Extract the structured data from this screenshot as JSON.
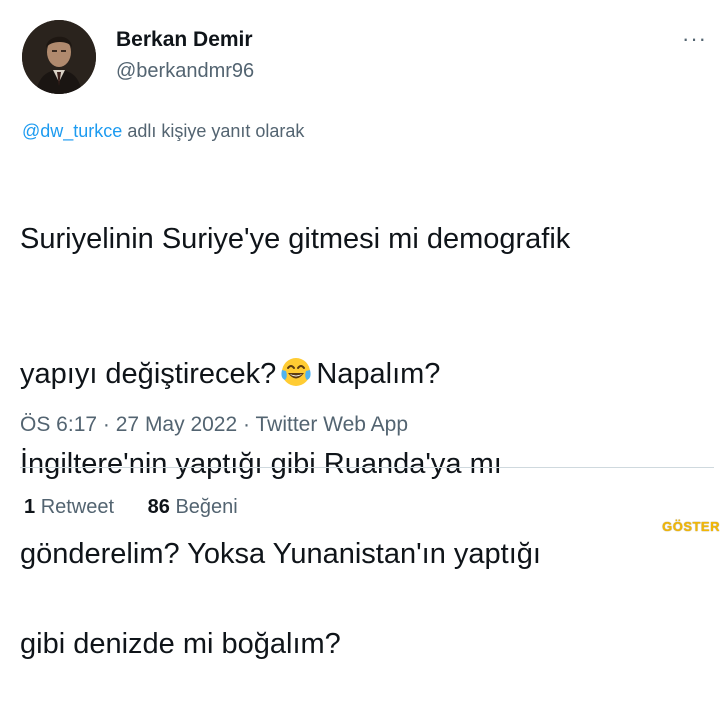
{
  "author": {
    "display_name": "Berkan Demir",
    "handle": "@berkandmr96",
    "avatar_icon": "profile-photo"
  },
  "more_label": "···",
  "reply": {
    "mention": "@dw_turkce",
    "suffix": "adlı kişiye yanıt olarak"
  },
  "tweet": {
    "line1": "Suriyelinin Suriye'ye gitmesi mi demografik",
    "line2_before_emoji": "yapıyı değiştirecek?",
    "emoji_icon": "face-with-tears-of-joy",
    "line2_after_emoji": "Napalım?",
    "line3": "İngiltere'nin yaptığı gibi Ruanda'ya mı",
    "line4": "gönderelim? Yoksa Yunanistan'ın yaptığı",
    "line5": "gibi denizde mi boğalım?"
  },
  "meta": {
    "time": "ÖS 6:17",
    "sep1": "·",
    "date": "27 May 2022",
    "sep2": "·",
    "app": "Twitter Web App"
  },
  "stats": {
    "retweet_count": "1",
    "retweet_label": "Retweet",
    "like_count": "86",
    "like_label": "Beğeni"
  },
  "watermark": "GÖSTER",
  "colors": {
    "link": "#1d9bf0",
    "secondary_text": "#536471",
    "primary_text": "#0f1419",
    "divider": "#cfd9de"
  }
}
